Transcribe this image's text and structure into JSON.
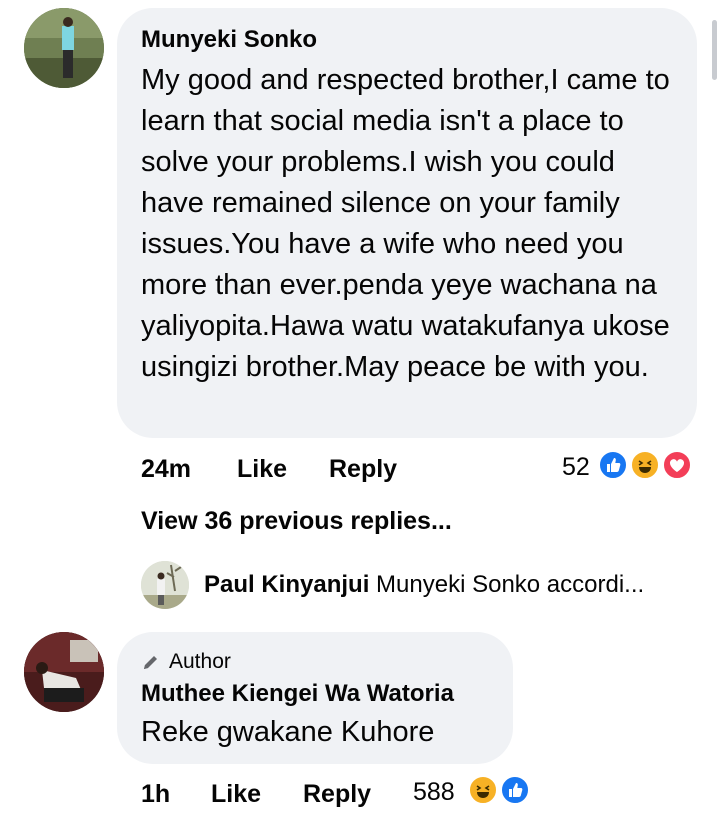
{
  "comment1": {
    "author": "Munyeki Sonko",
    "text": "My good and respected brother,I came to learn that social media isn't a place to solve your problems.I wish you could have remained silence on your family issues.You have a wife who need you more than ever.penda yeye wachana na yaliyopita.Hawa watu watakufanya ukose usingizi brother.May peace be with you.",
    "time": "24m",
    "like_label": "Like",
    "reply_label": "Reply",
    "reaction_count": "52",
    "reactions": [
      "like-icon",
      "haha-icon",
      "love-icon"
    ]
  },
  "view_previous": "View 36 previous replies...",
  "reply_preview": {
    "author": "Paul Kinyanjui",
    "text": "Munyeki Sonko accordi..."
  },
  "comment2": {
    "badge": "Author",
    "author": "Muthee Kiengei Wa Watoria",
    "text": "Reke gwakane Kuhore",
    "time": "1h",
    "like_label": "Like",
    "reply_label": "Reply",
    "reaction_count": "588",
    "reactions": [
      "haha-icon",
      "like-icon"
    ]
  },
  "colors": {
    "bubble": "#f0f2f5",
    "like_blue": "#1877f2",
    "haha_yellow": "#f7b125",
    "love_red": "#f33e58"
  }
}
